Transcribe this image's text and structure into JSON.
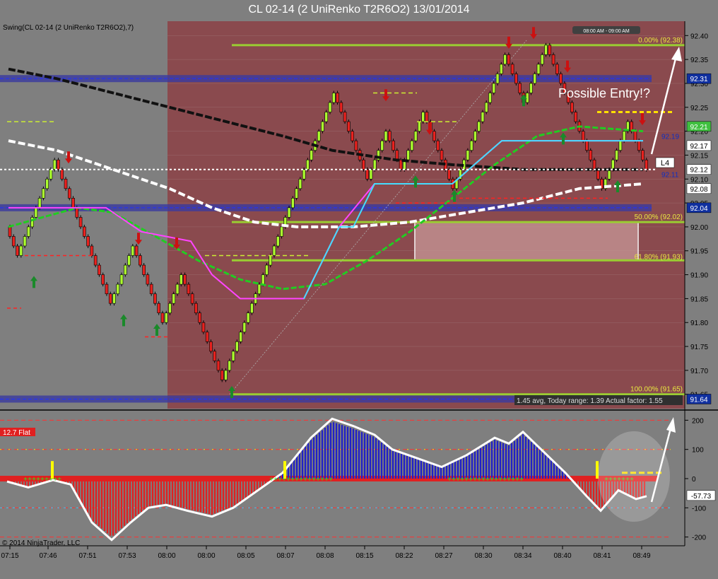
{
  "title": "CL 02-14 (2 UniRenko T2R6O2)  13/01/2014",
  "indicator_label": "Swing(CL 02-14 (2 UniRenko T2R6O2),7)",
  "session_box": "08:00 AM - 09:00 AM",
  "annotation": "Possible Entry!?",
  "marker_label": "L4",
  "stats_text": "1.45 avg, Today range: 1.39  Actual factor: 1.55",
  "flat_label": "12.7 Flat",
  "copyright": "© 2014 NinjaTrader, LLC",
  "fib_levels": [
    {
      "label": "0.00% (92.38)",
      "value": 92.38
    },
    {
      "label": "50.00% (92.02)",
      "value": 92.01
    },
    {
      "label": "61.80% (91.93)",
      "value": 91.93
    },
    {
      "label": "100.00% (91.65)",
      "value": 91.65
    }
  ],
  "colors": {
    "background": "#7f7f7f",
    "session_shade": "#8a4a4e",
    "up_brick": "#adff2f",
    "down_brick": "#e8221f",
    "fib_line": "#9acd32",
    "blue_band": "#3a3aa0",
    "price_tag": "#1030a0"
  },
  "chart_data": [
    {
      "type": "candlestick",
      "title": "CL 02-14 (2 UniRenko T2R6O2)  13/01/2014",
      "ylim": [
        91.62,
        92.43
      ],
      "y_ticks": [
        "92.40",
        "92.35",
        "92.30",
        "92.25",
        "92.20",
        "92.15",
        "92.10",
        "92.05",
        "92.00",
        "91.95",
        "91.90",
        "91.85",
        "91.80",
        "91.75",
        "91.70",
        "91.65"
      ],
      "x_ticks": [
        "07:15",
        "07:46",
        "07:51",
        "07:53",
        "08:00",
        "08:00",
        "08:05",
        "08:07",
        "08:08",
        "08:15",
        "08:22",
        "08:27",
        "08:30",
        "08:34",
        "08:40",
        "08:41",
        "08:49"
      ],
      "price_tags": [
        {
          "label": "92.31",
          "value": 92.31
        },
        {
          "label": "92.21",
          "value": 92.21
        },
        {
          "label": "92.19",
          "value": 92.19
        },
        {
          "label": "92.17",
          "value": 92.17
        },
        {
          "label": "92.12",
          "value": 92.12
        },
        {
          "label": "92.11",
          "value": 92.11
        },
        {
          "label": "92.08",
          "value": 92.08
        },
        {
          "label": "92.04",
          "value": 92.04
        },
        {
          "label": "91.64",
          "value": 91.64
        }
      ],
      "brick_path": [
        92.0,
        91.94,
        92.13,
        92.02,
        91.97,
        91.84,
        91.95,
        91.8,
        91.9,
        91.75,
        91.68,
        92.28,
        92.1,
        92.2,
        92.12,
        92.24,
        92.08,
        92.36,
        92.26,
        92.38,
        92.13,
        92.09,
        92.22,
        92.12
      ]
    },
    {
      "type": "bar",
      "title": "",
      "ylim": [
        -230,
        230
      ],
      "y_ticks": [
        "200",
        "100",
        "0",
        "-100",
        "-200"
      ],
      "current_value": "-57.73"
    }
  ]
}
